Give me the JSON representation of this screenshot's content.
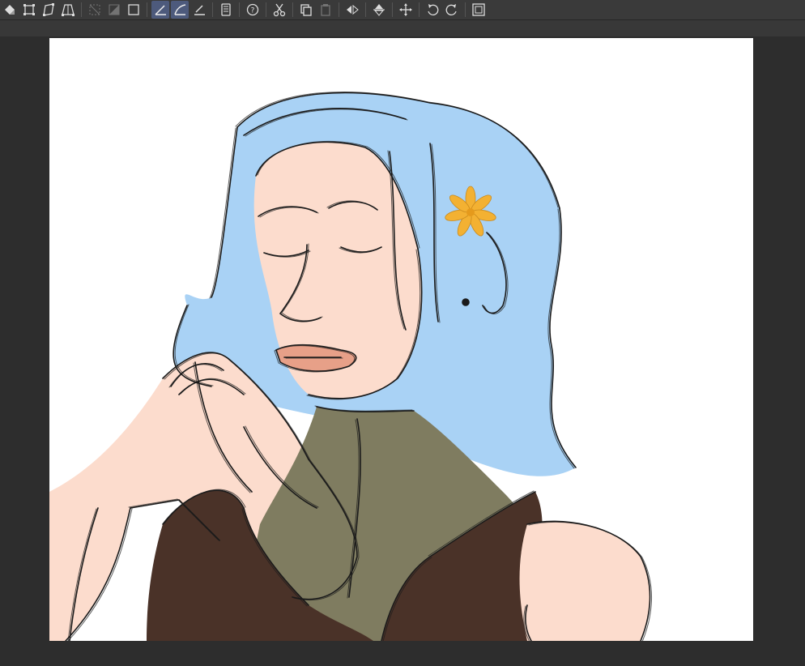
{
  "app": {
    "accent_active": "#4d5a7c",
    "workspace_color": "#2d2d2d",
    "toolbar_color": "#3a3a3a"
  },
  "toolbar": {
    "groups": [
      [
        {
          "name": "fill-selection-icon",
          "active": false,
          "disabled": false
        },
        {
          "name": "rect-transform-icon",
          "active": false,
          "disabled": false
        },
        {
          "name": "skew-transform-icon",
          "active": false,
          "disabled": false
        },
        {
          "name": "perspective-transform-icon",
          "active": false,
          "disabled": false
        }
      ],
      [
        {
          "name": "deselect-icon",
          "active": false,
          "disabled": true
        },
        {
          "name": "invert-selection-icon",
          "active": false,
          "disabled": true
        },
        {
          "name": "select-all-icon",
          "active": false,
          "disabled": false
        }
      ],
      [
        {
          "name": "ruler-straight-icon",
          "active": true,
          "disabled": false
        },
        {
          "name": "ruler-curve-icon",
          "active": true,
          "disabled": false
        },
        {
          "name": "ruler-edit-icon",
          "active": false,
          "disabled": false
        }
      ],
      [
        {
          "name": "layer-property-icon",
          "active": false,
          "disabled": false
        }
      ],
      [
        {
          "name": "help-bubble-icon",
          "active": false,
          "disabled": false
        }
      ],
      [
        {
          "name": "cut-icon",
          "active": false,
          "disabled": false
        }
      ],
      [
        {
          "name": "copy-icon",
          "active": false,
          "disabled": false
        },
        {
          "name": "paste-icon",
          "active": false,
          "disabled": true
        }
      ],
      [
        {
          "name": "flip-horizontal-icon",
          "active": false,
          "disabled": false
        }
      ],
      [
        {
          "name": "flip-vertical-icon",
          "active": false,
          "disabled": false
        }
      ],
      [
        {
          "name": "move-icon",
          "active": false,
          "disabled": false
        }
      ],
      [
        {
          "name": "rotate-left-icon",
          "active": false,
          "disabled": false
        },
        {
          "name": "rotate-right-icon",
          "active": false,
          "disabled": false
        }
      ],
      [
        {
          "name": "fit-canvas-icon",
          "active": false,
          "disabled": false
        }
      ]
    ]
  },
  "canvas": {
    "background": "#ffffff",
    "hair_color": "#a9d2f5",
    "skin_color": "#fcdccd",
    "turtleneck_color": "#7f7c60",
    "vest_color": "#4a3228",
    "flower_color": "#f3b132"
  }
}
